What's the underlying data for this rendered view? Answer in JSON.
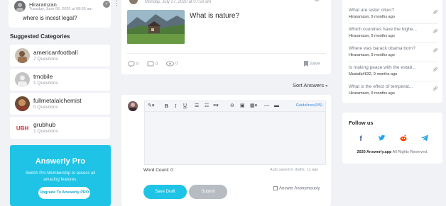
{
  "top_question": {
    "author": "Hiraramzan",
    "meta": "Tuesday, June 06, 2020 at 08:55 am",
    "title": "where is incest legal?"
  },
  "suggested": {
    "heading": "Suggested Categories",
    "items": [
      {
        "name": "americanfootball",
        "count": "7 Questions"
      },
      {
        "name": "tmobile",
        "count": "1 Questions"
      },
      {
        "name": "fullmetalalchemist",
        "count": "0 Questions"
      },
      {
        "name": "grubhub",
        "count": "1 Questions"
      }
    ]
  },
  "pro": {
    "title": "Answerly Pro",
    "desc": "Switch Pro Membership to access all amazing features.",
    "button": "Upgrade To Answerly PRO"
  },
  "post": {
    "date": "Monday, July 27, 2020 at 07:50 am",
    "title": "What is nature?",
    "stats": {
      "answers": "0",
      "comments": "0",
      "views": "0"
    },
    "save_label": "Save"
  },
  "sort": {
    "label": "Sort Answers"
  },
  "editor": {
    "guidelines": "Guidelines(0/5)",
    "word_count": "Word Count: 0",
    "autosave": "Auto saved in drafts: 1s ago",
    "save_draft": "Save Draft",
    "submit": "Submit",
    "anonymous": "Answer Anonymously"
  },
  "related": {
    "items": [
      {
        "title": "What are sister cities?",
        "meta": "Hiraramzan, 9 months ago"
      },
      {
        "title": "Which countries have the highe...",
        "meta": "Hiraramzan, 9 months ago"
      },
      {
        "title": "Where was barack obama born?",
        "meta": "Hiraramzan, 9 months ago"
      },
      {
        "title": "Is making peace with the estab...",
        "meta": "Mustafa4632, 9 months ago"
      },
      {
        "title": "What is the effect of temperat...",
        "meta": "Hiraramzan, 9 months ago"
      }
    ]
  },
  "follow": {
    "title": "Follow us",
    "copyright_brand": "2020 Answerly.app",
    "copyright_rest": " All Rights Reserved.",
    "colors": {
      "facebook": "#3b5998",
      "twitter": "#1da1f2",
      "reddit": "#ff4500",
      "telegram": "#2aa3df"
    }
  },
  "colors": {
    "accent": "#1ec3e6",
    "link": "#3b8ae0"
  }
}
